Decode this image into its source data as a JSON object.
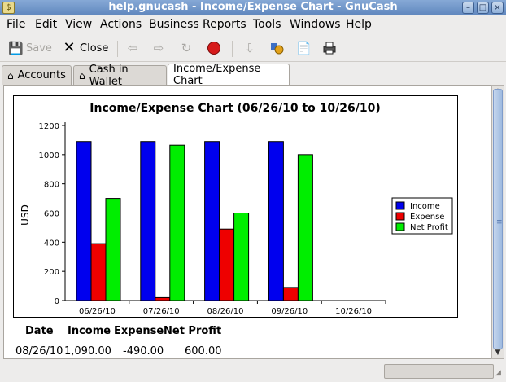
{
  "window": {
    "title": "help.gnucash - Income/Expense Chart - GnuCash",
    "minimize": "–",
    "maximize": "□",
    "close": "×"
  },
  "menu": [
    "File",
    "Edit",
    "View",
    "Actions",
    "Business",
    "Reports",
    "Tools",
    "Windows",
    "Help"
  ],
  "toolbar": {
    "save_label": "Save",
    "close_label": "Close"
  },
  "tabs": [
    {
      "label": "Accounts",
      "icon": "home-icon"
    },
    {
      "label": "Cash in Wallet",
      "icon": "home-icon"
    },
    {
      "label": "Income/Expense Chart",
      "icon": ""
    }
  ],
  "chart_data": {
    "type": "bar",
    "title": "Income/Expense Chart (06/26/10 to 10/26/10)",
    "ylabel": "USD",
    "xlabel": "",
    "ylim": [
      0,
      1200
    ],
    "yticks": [
      0,
      200,
      400,
      600,
      800,
      1000,
      1200
    ],
    "categories": [
      "06/26/10",
      "07/26/10",
      "08/26/10",
      "09/26/10",
      "10/26/10"
    ],
    "series": [
      {
        "name": "Income",
        "color": "#0000ee",
        "values": [
          1090,
          1090,
          1090,
          1090,
          0
        ]
      },
      {
        "name": "Expense",
        "color": "#ee0000",
        "values": [
          390,
          20,
          490,
          90,
          0
        ]
      },
      {
        "name": "Net Profit",
        "color": "#00ee00",
        "values": [
          700,
          1065,
          600,
          1000,
          0
        ]
      }
    ],
    "legend": "right",
    "grid": false
  },
  "table": {
    "headers": [
      "Date",
      "Income",
      "Expense",
      "Net Profit"
    ],
    "row": [
      "08/26/10",
      "1,090.00",
      "-490.00",
      "600.00"
    ]
  }
}
